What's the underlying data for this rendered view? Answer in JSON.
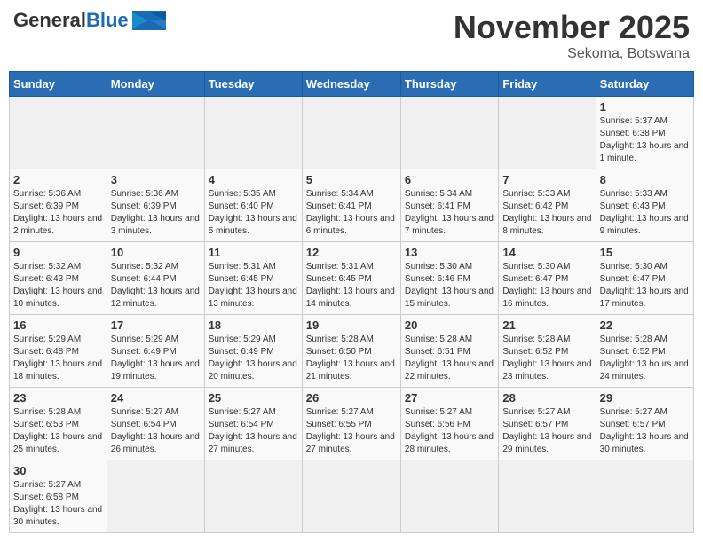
{
  "header": {
    "logo_general": "General",
    "logo_blue": "Blue",
    "month_title": "November 2025",
    "subtitle": "Sekoma, Botswana"
  },
  "days_of_week": [
    "Sunday",
    "Monday",
    "Tuesday",
    "Wednesday",
    "Thursday",
    "Friday",
    "Saturday"
  ],
  "weeks": [
    [
      {
        "day": "",
        "info": ""
      },
      {
        "day": "",
        "info": ""
      },
      {
        "day": "",
        "info": ""
      },
      {
        "day": "",
        "info": ""
      },
      {
        "day": "",
        "info": ""
      },
      {
        "day": "",
        "info": ""
      },
      {
        "day": "1",
        "info": "Sunrise: 5:37 AM\nSunset: 6:38 PM\nDaylight: 13 hours and 1 minute."
      }
    ],
    [
      {
        "day": "2",
        "info": "Sunrise: 5:36 AM\nSunset: 6:39 PM\nDaylight: 13 hours and 2 minutes."
      },
      {
        "day": "3",
        "info": "Sunrise: 5:36 AM\nSunset: 6:39 PM\nDaylight: 13 hours and 3 minutes."
      },
      {
        "day": "4",
        "info": "Sunrise: 5:35 AM\nSunset: 6:40 PM\nDaylight: 13 hours and 5 minutes."
      },
      {
        "day": "5",
        "info": "Sunrise: 5:34 AM\nSunset: 6:41 PM\nDaylight: 13 hours and 6 minutes."
      },
      {
        "day": "6",
        "info": "Sunrise: 5:34 AM\nSunset: 6:41 PM\nDaylight: 13 hours and 7 minutes."
      },
      {
        "day": "7",
        "info": "Sunrise: 5:33 AM\nSunset: 6:42 PM\nDaylight: 13 hours and 8 minutes."
      },
      {
        "day": "8",
        "info": "Sunrise: 5:33 AM\nSunset: 6:43 PM\nDaylight: 13 hours and 9 minutes."
      }
    ],
    [
      {
        "day": "9",
        "info": "Sunrise: 5:32 AM\nSunset: 6:43 PM\nDaylight: 13 hours and 10 minutes."
      },
      {
        "day": "10",
        "info": "Sunrise: 5:32 AM\nSunset: 6:44 PM\nDaylight: 13 hours and 12 minutes."
      },
      {
        "day": "11",
        "info": "Sunrise: 5:31 AM\nSunset: 6:45 PM\nDaylight: 13 hours and 13 minutes."
      },
      {
        "day": "12",
        "info": "Sunrise: 5:31 AM\nSunset: 6:45 PM\nDaylight: 13 hours and 14 minutes."
      },
      {
        "day": "13",
        "info": "Sunrise: 5:30 AM\nSunset: 6:46 PM\nDaylight: 13 hours and 15 minutes."
      },
      {
        "day": "14",
        "info": "Sunrise: 5:30 AM\nSunset: 6:47 PM\nDaylight: 13 hours and 16 minutes."
      },
      {
        "day": "15",
        "info": "Sunrise: 5:30 AM\nSunset: 6:47 PM\nDaylight: 13 hours and 17 minutes."
      }
    ],
    [
      {
        "day": "16",
        "info": "Sunrise: 5:29 AM\nSunset: 6:48 PM\nDaylight: 13 hours and 18 minutes."
      },
      {
        "day": "17",
        "info": "Sunrise: 5:29 AM\nSunset: 6:49 PM\nDaylight: 13 hours and 19 minutes."
      },
      {
        "day": "18",
        "info": "Sunrise: 5:29 AM\nSunset: 6:49 PM\nDaylight: 13 hours and 20 minutes."
      },
      {
        "day": "19",
        "info": "Sunrise: 5:28 AM\nSunset: 6:50 PM\nDaylight: 13 hours and 21 minutes."
      },
      {
        "day": "20",
        "info": "Sunrise: 5:28 AM\nSunset: 6:51 PM\nDaylight: 13 hours and 22 minutes."
      },
      {
        "day": "21",
        "info": "Sunrise: 5:28 AM\nSunset: 6:52 PM\nDaylight: 13 hours and 23 minutes."
      },
      {
        "day": "22",
        "info": "Sunrise: 5:28 AM\nSunset: 6:52 PM\nDaylight: 13 hours and 24 minutes."
      }
    ],
    [
      {
        "day": "23",
        "info": "Sunrise: 5:28 AM\nSunset: 6:53 PM\nDaylight: 13 hours and 25 minutes."
      },
      {
        "day": "24",
        "info": "Sunrise: 5:27 AM\nSunset: 6:54 PM\nDaylight: 13 hours and 26 minutes."
      },
      {
        "day": "25",
        "info": "Sunrise: 5:27 AM\nSunset: 6:54 PM\nDaylight: 13 hours and 27 minutes."
      },
      {
        "day": "26",
        "info": "Sunrise: 5:27 AM\nSunset: 6:55 PM\nDaylight: 13 hours and 27 minutes."
      },
      {
        "day": "27",
        "info": "Sunrise: 5:27 AM\nSunset: 6:56 PM\nDaylight: 13 hours and 28 minutes."
      },
      {
        "day": "28",
        "info": "Sunrise: 5:27 AM\nSunset: 6:57 PM\nDaylight: 13 hours and 29 minutes."
      },
      {
        "day": "29",
        "info": "Sunrise: 5:27 AM\nSunset: 6:57 PM\nDaylight: 13 hours and 30 minutes."
      }
    ],
    [
      {
        "day": "30",
        "info": "Sunrise: 5:27 AM\nSunset: 6:58 PM\nDaylight: 13 hours and 30 minutes."
      },
      {
        "day": "",
        "info": ""
      },
      {
        "day": "",
        "info": ""
      },
      {
        "day": "",
        "info": ""
      },
      {
        "day": "",
        "info": ""
      },
      {
        "day": "",
        "info": ""
      },
      {
        "day": "",
        "info": ""
      }
    ]
  ]
}
